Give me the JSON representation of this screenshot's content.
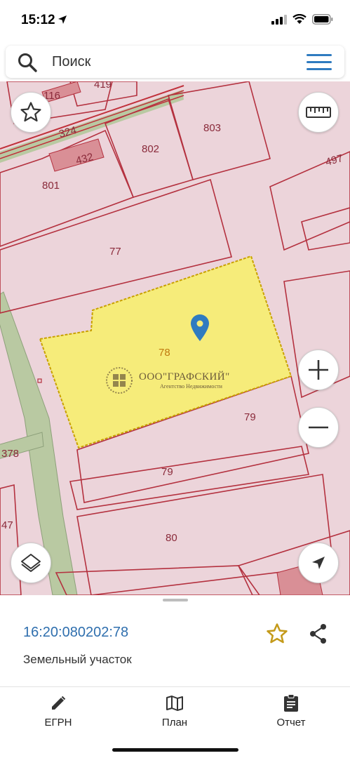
{
  "status_bar": {
    "time": "15:12"
  },
  "search": {
    "placeholder": "Поиск"
  },
  "map": {
    "parcel_labels": [
      "419",
      "116",
      "432",
      "801",
      "802",
      "803",
      "497",
      "77",
      "79",
      "79",
      "80",
      "378",
      "47"
    ],
    "segment_label": "324",
    "selected_parcel_label": "78",
    "watermark": {
      "title": "ООО\"ГРАФСКИЙ\"",
      "subtitle": "Агентство Недвижимости"
    },
    "colors": {
      "background": "#ecd4da",
      "parcel_border": "#b4313f",
      "selected_fill": "#f6ec7a",
      "road": "#b9c9a2",
      "marker": "#2f7bc0"
    }
  },
  "selected_object": {
    "cadastral_number": "16:20:080202:78",
    "type": "Земельный участок"
  },
  "bottom_nav": {
    "items": [
      {
        "label": "ЕГРН",
        "icon": "pencil-icon"
      },
      {
        "label": "План",
        "icon": "map-icon"
      },
      {
        "label": "Отчет",
        "icon": "clipboard-icon"
      }
    ]
  }
}
